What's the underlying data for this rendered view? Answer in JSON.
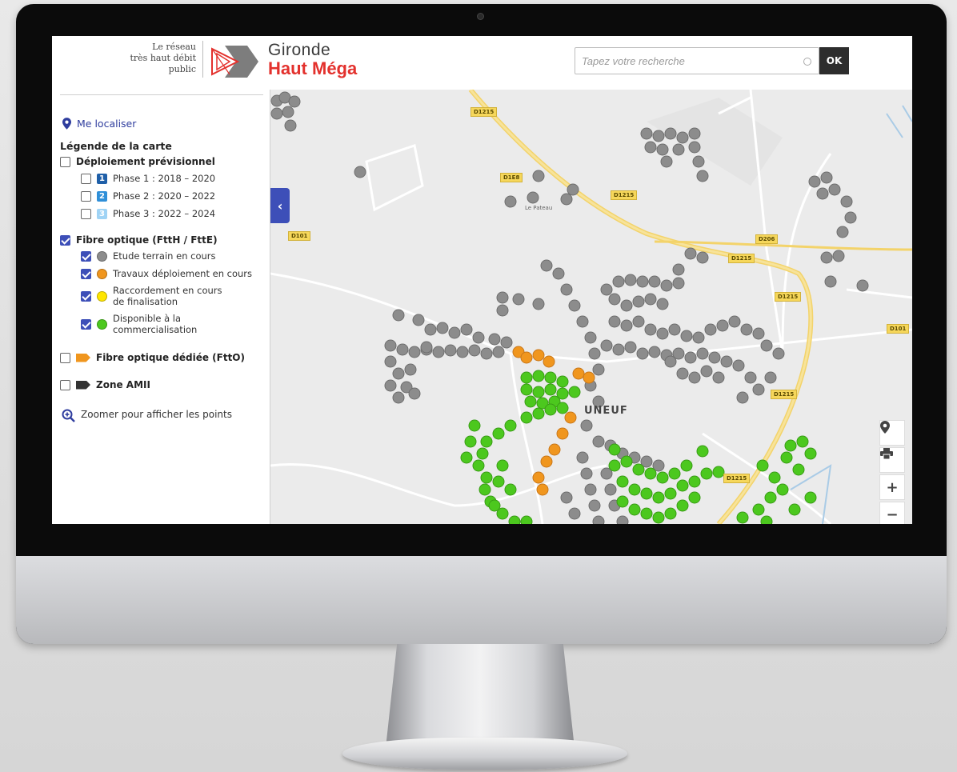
{
  "header": {
    "tagline": [
      "Le réseau",
      "très haut débit",
      "public"
    ],
    "brand_line1": "Gironde",
    "brand_line2": "Haut Méga",
    "search_placeholder": "Tapez votre recherche",
    "ok_label": "OK"
  },
  "sidebar": {
    "locate_label": "Me localiser",
    "legend_title": "Légende de la carte",
    "deployment_label": "Déploiement prévisionnel",
    "phases": [
      {
        "num": "1",
        "label": "Phase 1 : 2018 – 2020",
        "color": "#1f5fa8"
      },
      {
        "num": "2",
        "label": "Phase 2 : 2020 – 2022",
        "color": "#2f8fd8"
      },
      {
        "num": "3",
        "label": "Phase 3 : 2022 – 2024",
        "color": "#9fd3f5"
      }
    ],
    "fibre_label": "Fibre optique (FttH / FttE)",
    "fibre_items": [
      {
        "label": "Etude terrain en cours",
        "color": "#8c8c8c"
      },
      {
        "label": "Travaux déploiement en cours",
        "color": "#f0961e"
      },
      {
        "label": "Raccordement en cours de finalisation",
        "color": "#ffe600"
      },
      {
        "label": "Disponible à la commercialisation",
        "color": "#4cc81e"
      }
    ],
    "fibre_dedicated_label": "Fibre optique dédiée (FttO)",
    "zone_label": "Zone AMII",
    "zoom_hint": "Zoomer pour afficher les points"
  },
  "map": {
    "town_label": "UNEUF",
    "place_label": "Le Pateau",
    "road_labels": [
      "D1215",
      "D1E8",
      "D1215",
      "D101",
      "D206",
      "D1215",
      "D1215",
      "D101",
      "D1215",
      "D1215"
    ]
  },
  "colors": {
    "accent": "#3d4fb8",
    "brand_red": "#e3312d",
    "gray": "#8c8c8c",
    "orange": "#f0961e",
    "green": "#4cc81e"
  }
}
